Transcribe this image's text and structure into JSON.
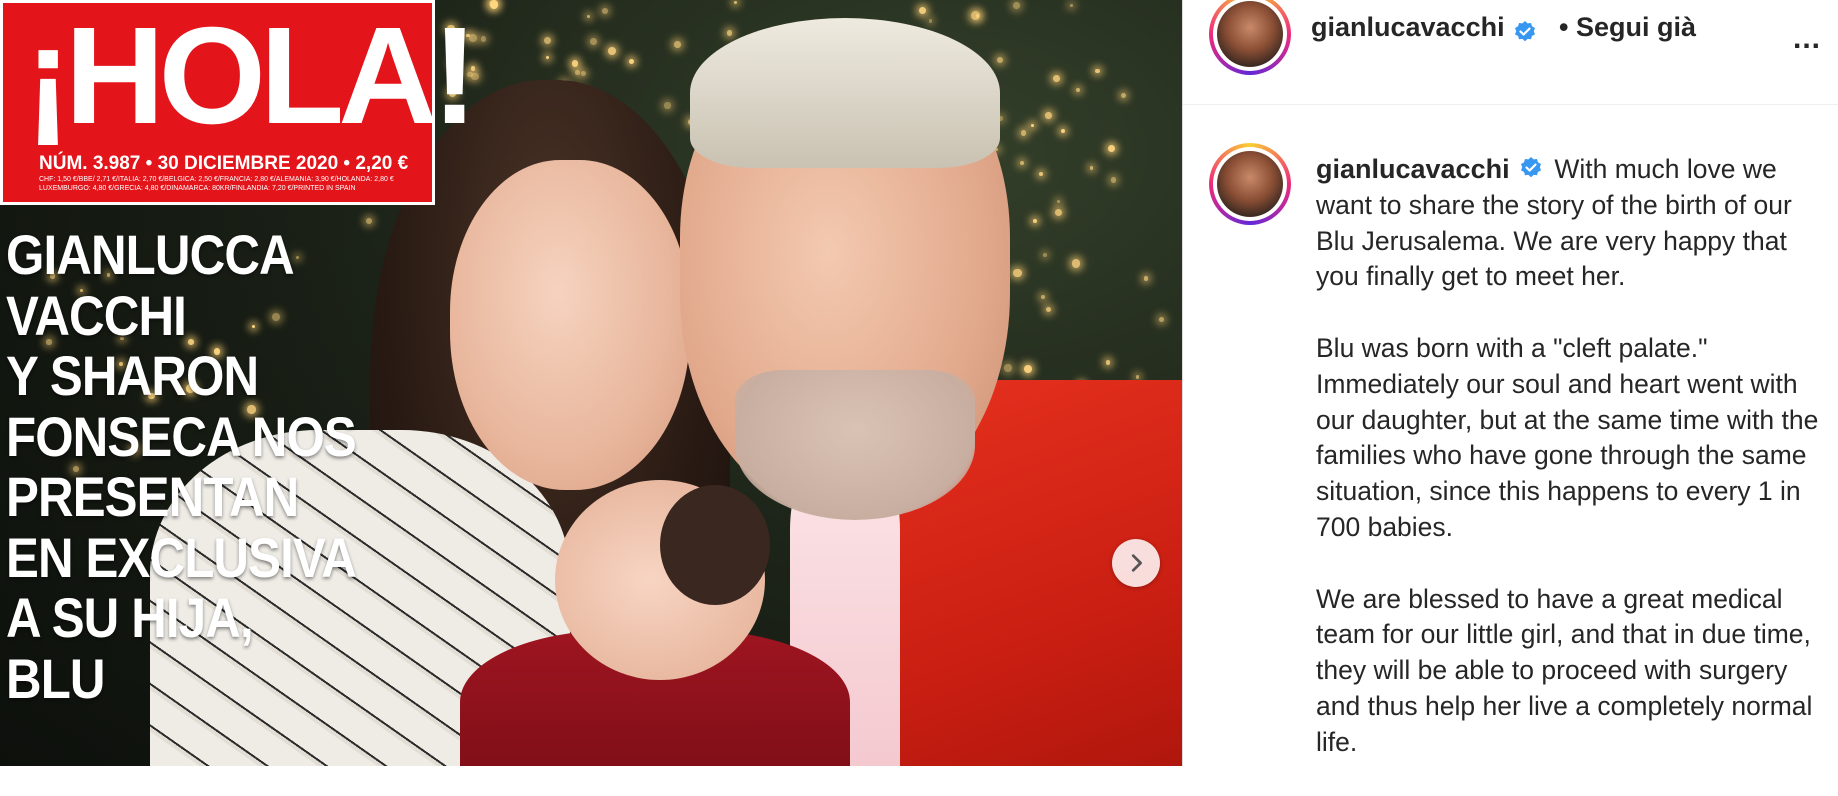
{
  "media": {
    "magazine_logo": "¡HOLA!",
    "issue_line": "NÚM. 3.987 • 30 DICIEMBRE 2020 • 2,20 €",
    "fine_print": "CHF: 1,50 €/BBE/ 2,71 €/ITALIA: 2,70 €/BELGICA: 2,50 €/FRANCIA: 2,80 €/ALEMANIA: 3,90 €/HOLANDA: 2,80 € LUXEMBURGO: 4,80 €/GRECIA: 4,80 €/DINAMARCA: 80KR/FINLANDIA: 7,20 €/PRINTED IN SPAIN",
    "headline_lines": [
      "GIANLUCCA",
      "VACCHI",
      "Y SHARON",
      "FONSECA NOS",
      "PRESENTAN",
      "EN EXCLUSIVA",
      "A SU HIJA,",
      "BLU"
    ],
    "next_icon": "chevron-right-icon"
  },
  "post": {
    "username": "gianlucavacchi",
    "verified": true,
    "follow_status": "• Segui già",
    "more_icon": "more-options-icon",
    "more_label": "...",
    "caption_paragraphs": [
      "With much love we want to share the story of the birth of our Blu Jerusalema. We are very happy that you finally get to meet her.",
      "Blu was born with a \"cleft palate.\" Immediately our soul and heart went with our daughter, but at the same time with the families who have gone through the same situation, since this happens to every 1 in 700 babies.",
      "We are blessed to have a great medical team for our little girl, and that in due time, they will be able to proceed with surgery and thus help her live a completely normal life."
    ]
  },
  "colors": {
    "verified_blue": "#3897f0",
    "text": "#262626",
    "magazine_red": "#e4141b"
  }
}
